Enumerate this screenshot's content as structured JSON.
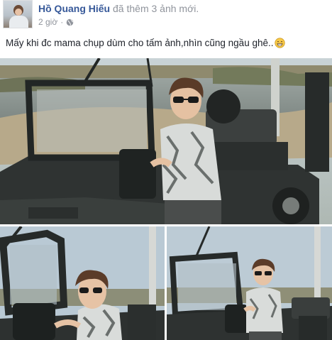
{
  "post": {
    "author_name": "Hồ Quang Hiếu",
    "action_text": "đã thêm 3 ảnh mới.",
    "timestamp": "2 giờ",
    "separator": "·",
    "audience_icon": "globe-icon",
    "caption": "Mấy khi đc mama chụp dùm cho tấm ảnh,nhìn cũng ngầu ghê..",
    "caption_emoji": "grinning-face-emoji"
  },
  "photos": [
    {
      "id": "main",
      "subject": "man-in-jeep"
    },
    {
      "id": "left",
      "subject": "man-in-jeep"
    },
    {
      "id": "right",
      "subject": "man-in-jeep"
    }
  ],
  "colors": {
    "link": "#365899",
    "meta": "#90949c",
    "text": "#1d2129"
  }
}
